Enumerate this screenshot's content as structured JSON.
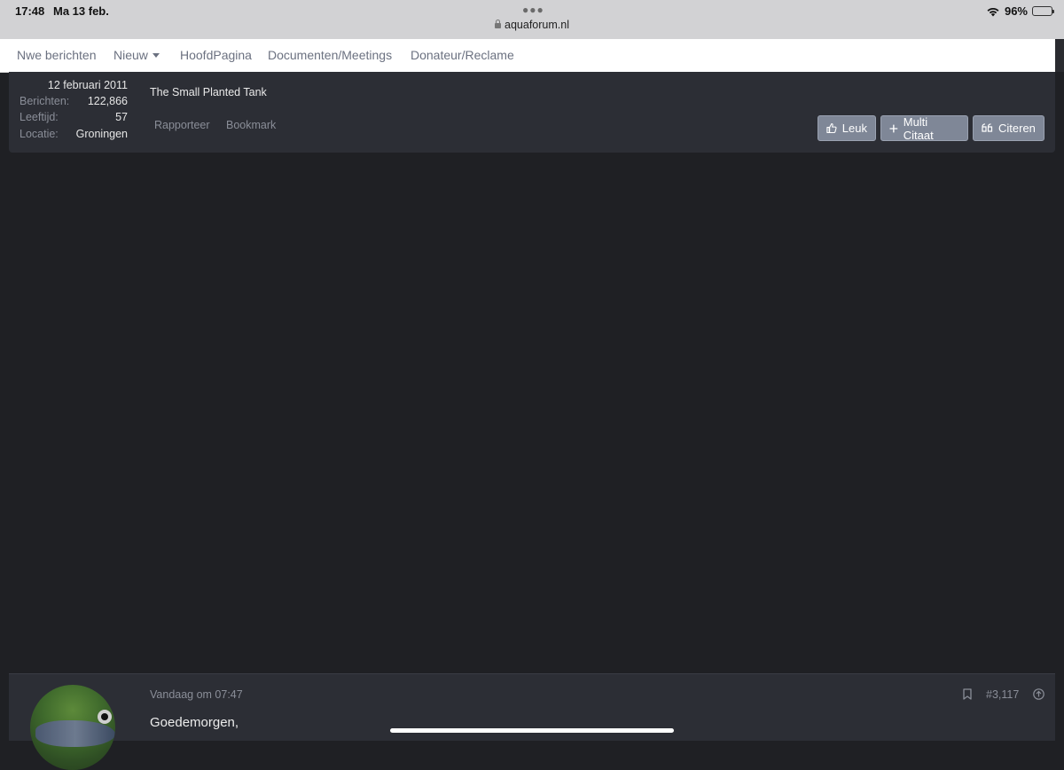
{
  "status_bar": {
    "time": "17:48",
    "date": "Ma 13 feb.",
    "url": "aquaforum.nl",
    "battery": "96%"
  },
  "nav": {
    "items": [
      {
        "label": "Nwe berichten"
      },
      {
        "label": "Nieuw"
      },
      {
        "label": "HoofdPagina"
      },
      {
        "label": "Documenten/Meetings"
      },
      {
        "label": "Donateur/Reclame"
      }
    ]
  },
  "post1": {
    "join_date": "12 februari 2011",
    "stats": [
      {
        "label": "Berichten:",
        "value": "122,866"
      },
      {
        "label": "Leeftijd:",
        "value": "57"
      },
      {
        "label": "Locatie:",
        "value": "Groningen"
      }
    ],
    "signature": "The Small Planted Tank",
    "links": {
      "report": "Rapporteer",
      "bookmark": "Bookmark"
    },
    "buttons": {
      "like": "Leuk",
      "multi_quote": "Multi Citaat",
      "quote": "Citeren"
    }
  },
  "post2": {
    "date": "Vandaag om 07:47",
    "post_number": "#3,117",
    "greeting": "Goedemorgen,"
  },
  "colors": {
    "background": "#1f2024",
    "card": "#2c2e35",
    "button": "#7f8797",
    "nav_text": "#6b7180"
  }
}
